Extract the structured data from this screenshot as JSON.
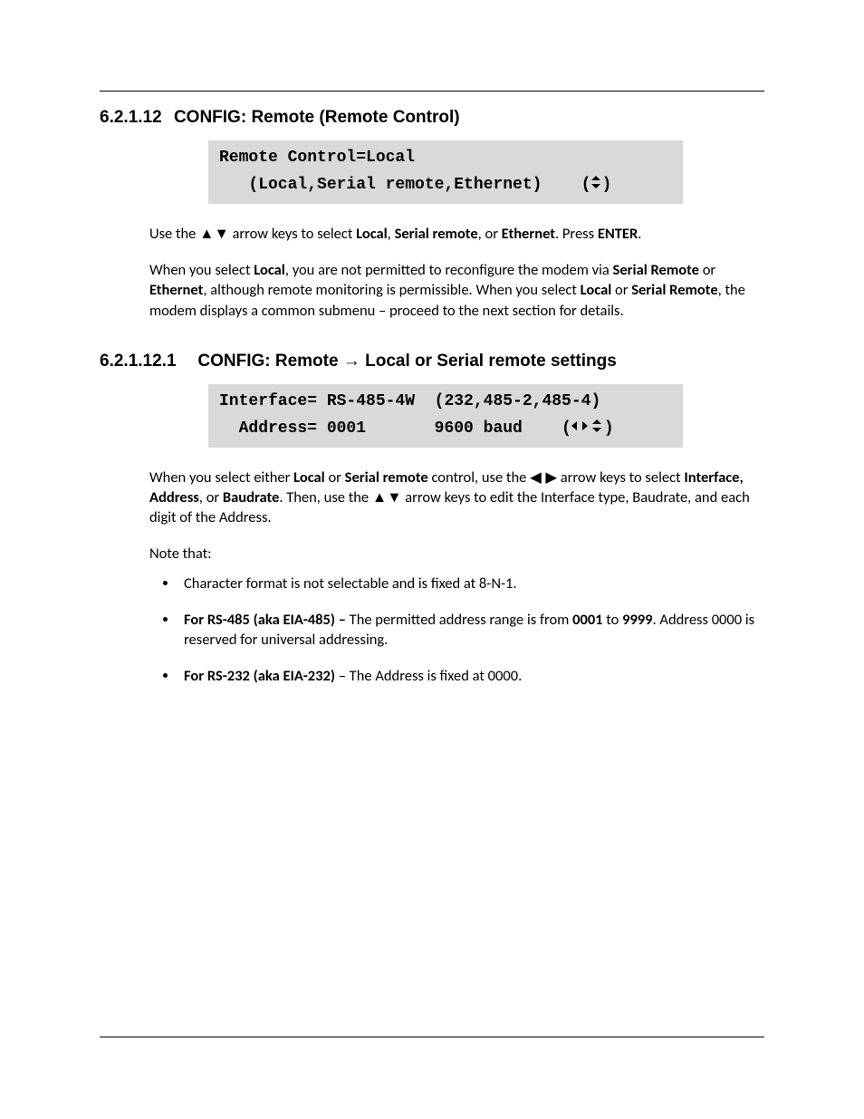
{
  "section1": {
    "number": "6.2.1.12",
    "title": "CONFIG: Remote (Remote Control)",
    "lcd": {
      "line1": "Remote Control=Local",
      "line2_pre": "   (Local,Serial remote,Ethernet)    (",
      "line2_post": ")"
    },
    "para1_pre": "Use the ",
    "para1_arrows": "▲▼",
    "para1_mid1": " arrow keys to select ",
    "para1_b1": "Local",
    "para1_sep1": ", ",
    "para1_b2": "Serial remote",
    "para1_sep2": ", or ",
    "para1_b3": "Ethernet",
    "para1_sep3": ". Press ",
    "para1_b4": "ENTER",
    "para1_end": ".",
    "para2_a": "When you select ",
    "para2_b1": "Local",
    "para2_b": ", you are not permitted to reconfigure the modem via ",
    "para2_b2": "Serial Remote",
    "para2_c": " or ",
    "para2_b3": "Ethernet",
    "para2_d": ", although remote monitoring is permissible. When you select ",
    "para2_b4": "Local",
    "para2_e": " or ",
    "para2_b5": "Serial Remote",
    "para2_f": ", the modem displays a common submenu – proceed to the next section for details."
  },
  "section2": {
    "number": "6.2.1.12.1",
    "title_pre": "CONFIG: Remote ",
    "title_arrow": "→",
    "title_post": " Local or Serial remote settings",
    "lcd": {
      "line1": "Interface= RS-485-4W  (232,485-2,485-4)",
      "line2_pre": "  Address= 0001       9600 baud    (",
      "line2_post": ")"
    },
    "para1_a": "When you select either ",
    "para1_b1": "Local",
    "para1_b": " or ",
    "para1_b2": "Serial remote",
    "para1_c": " control, use the ",
    "para1_lr": "◀ ▶",
    "para1_d": " arrow keys to select ",
    "para1_b3": "Interface, Address",
    "para1_e": ", or ",
    "para1_b4": "Baudrate",
    "para1_f": ". Then, use the ",
    "para1_ud": "▲▼",
    "para1_g": " arrow keys to edit the Interface type, Baudrate, and each digit of the Address.",
    "note_intro": "Note that:",
    "bullets": {
      "b1": "Character format is not selectable and is fixed at 8-N-1.",
      "b2_bold": "For RS-485 (aka EIA-485) – ",
      "b2_a": "The permitted address range is from ",
      "b2_v1": "0001",
      "b2_b": " to ",
      "b2_v2": "9999",
      "b2_c": ". Address 0000 is reserved for universal addressing.",
      "b3_bold": "For RS-232 (aka EIA-232) ",
      "b3_rest": " – The Address is fixed at 0000."
    }
  }
}
